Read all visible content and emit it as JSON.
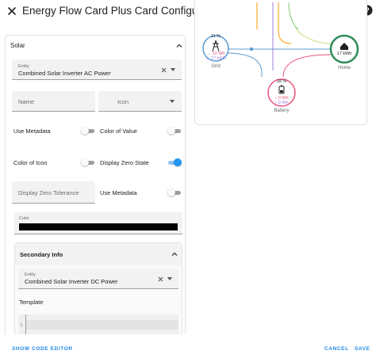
{
  "dialog": {
    "title": "Energy Flow Card Plus Card Configuration",
    "close_icon": "close-icon",
    "help_icon": "help-circle-icon"
  },
  "solar": {
    "section_title": "Solar",
    "entity": {
      "label": "Entity",
      "value": "Combined Solar Inverter AC Power"
    },
    "name": {
      "placeholder": "Name",
      "value": ""
    },
    "icon": {
      "placeholder": "Icon",
      "value": ""
    },
    "use_metadata": {
      "label": "Use Metadata",
      "on": false
    },
    "color_of_value": {
      "label": "Color of Value",
      "on": false
    },
    "color_of_icon": {
      "label": "Color of Icon",
      "on": false
    },
    "display_zero_state": {
      "label": "Display Zero State",
      "on": true
    },
    "display_zero_tolerance": {
      "placeholder": "Display Zero Tolerance",
      "value": ""
    },
    "use_metadata_2": {
      "label": "Use Metadata",
      "on": false
    },
    "color": {
      "label": "Color",
      "value": "#000000"
    },
    "secondary_info": {
      "title": "Secondary Info",
      "entity": {
        "label": "Entity",
        "value": "Combined Solar Inverter DC Power"
      },
      "template_label": "Template",
      "code_line_number": "1"
    }
  },
  "preview": {
    "grid": {
      "percent": "11 %",
      "from": "→ 10 Wh",
      "to": "← 17 kWh",
      "label": "Grid"
    },
    "home": {
      "value": "17 kWh",
      "label": "Home"
    },
    "battery": {
      "percent": "18 %",
      "in": "↓ 0 Wh",
      "out": "↑ 0 Wh",
      "label": "Battery"
    },
    "colors": {
      "grid": "#5b9bd5",
      "home": "#2e8b57",
      "battery": "#e8537a",
      "solar": "#ff9800",
      "return": "#a280db"
    }
  },
  "footer": {
    "show_code_editor": "SHOW CODE EDITOR",
    "cancel": "CANCEL",
    "save": "SAVE"
  }
}
